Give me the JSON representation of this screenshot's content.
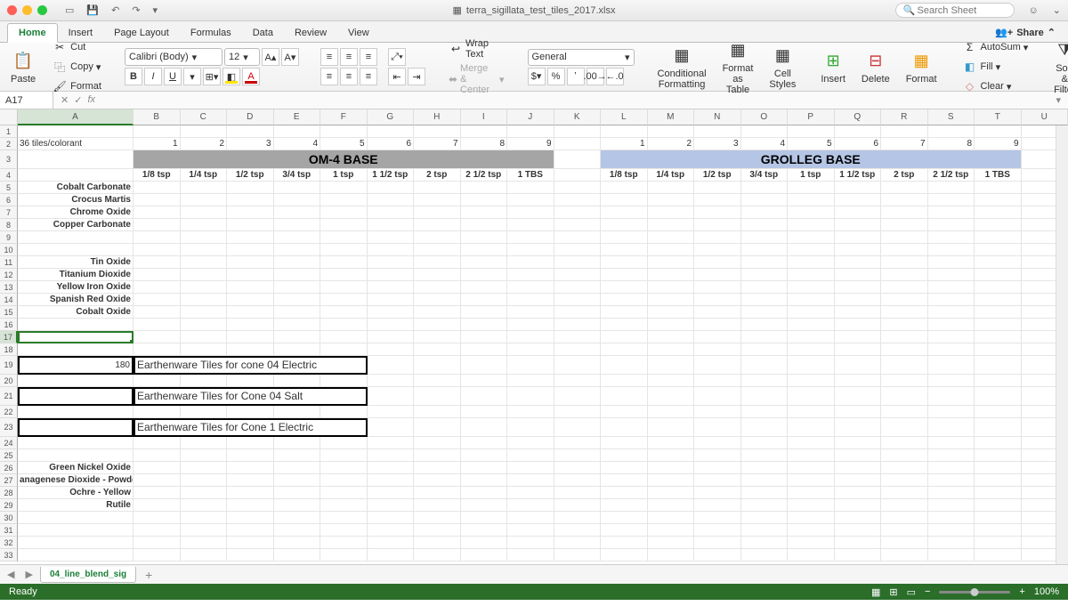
{
  "title": "terra_sigillata_test_tiles_2017.xlsx",
  "search_placeholder": "Search Sheet",
  "tabs": [
    "Home",
    "Insert",
    "Page Layout",
    "Formulas",
    "Data",
    "Review",
    "View"
  ],
  "share": "Share",
  "clipboard": {
    "cut": "Cut",
    "copy": "Copy",
    "format": "Format",
    "paste": "Paste"
  },
  "font_name": "Calibri (Body)",
  "font_size": "12",
  "wrap": "Wrap Text",
  "merge": "Merge & Center",
  "num_format": "General",
  "cond": "Conditional Formatting",
  "fat": "Format as Table",
  "cstyles": "Cell Styles",
  "insert": "Insert",
  "delete": "Delete",
  "format": "Format",
  "autosum": "AutoSum",
  "fill": "Fill",
  "clear": "Clear",
  "sortfilter": "Sort & Filter",
  "cell_ref": "A17",
  "sheet_tab": "04_line_blend_sig",
  "status": "Ready",
  "zoom": "100%",
  "cols": [
    "A",
    "B",
    "C",
    "D",
    "E",
    "F",
    "G",
    "H",
    "I",
    "J",
    "K",
    "L",
    "M",
    "N",
    "O",
    "P",
    "Q",
    "R",
    "S",
    "T",
    "U"
  ],
  "row2_a": "36 tiles/colorant",
  "nums": [
    "1",
    "2",
    "3",
    "4",
    "5",
    "6",
    "7",
    "8",
    "9"
  ],
  "base1": "OM-4 BASE",
  "base2": "GROLLEG BASE",
  "measures": [
    "1/8 tsp",
    "1/4 tsp",
    "1/2 tsp",
    "3/4 tsp",
    "1 tsp",
    "1 1/2 tsp",
    "2 tsp",
    "2 1/2 tsp",
    "1 TBS"
  ],
  "colorants1": [
    "Cobalt Carbonate",
    "Crocus Martis",
    "Chrome Oxide",
    "Copper Carbonate"
  ],
  "colorants2": [
    "Tin Oxide",
    "Titanium Dioxide",
    "Yellow Iron Oxide",
    "Spanish Red Oxide",
    "Cobalt Oxide"
  ],
  "val180": "180",
  "note19": "Earthenware Tiles for cone 04 Electric",
  "note21": "Earthenware Tiles for Cone 04 Salt",
  "note23": "Earthenware Tiles for Cone 1 Electric",
  "colorants3": [
    "Green Nickel Oxide",
    "anagenese Dioxide - Powdered",
    "Ochre - Yellow",
    "Rutile"
  ]
}
